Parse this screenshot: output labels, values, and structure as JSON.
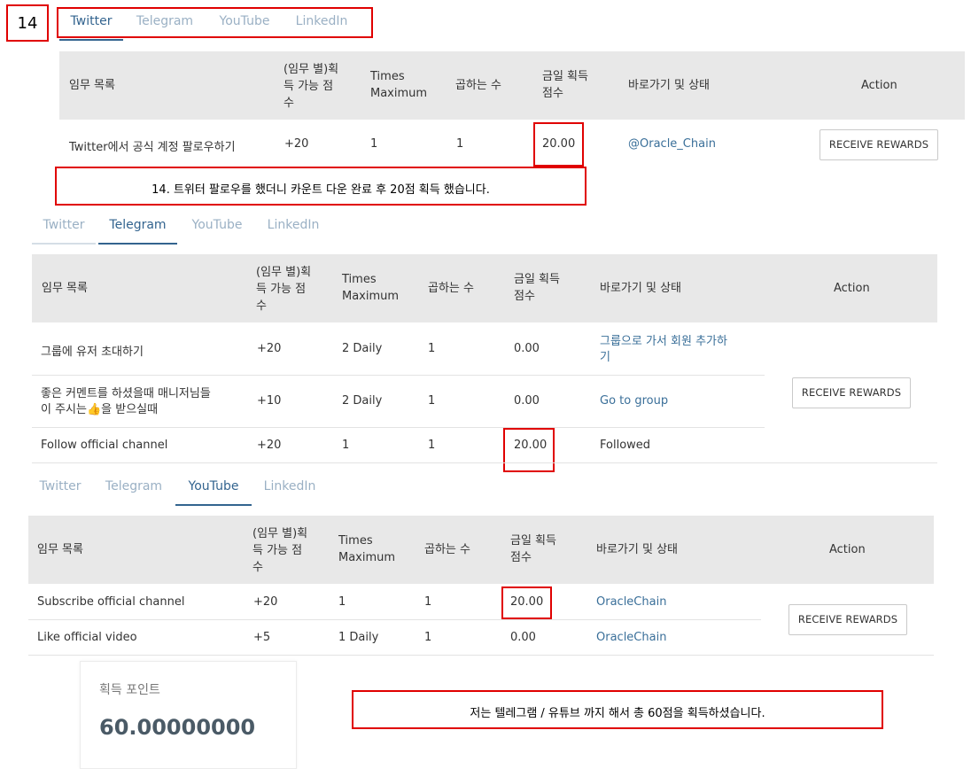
{
  "step_number": "14",
  "tab_labels": [
    "Twitter",
    "Telegram",
    "YouTube",
    "LinkedIn"
  ],
  "table_headers": [
    "임무 목록",
    "(임무 별)획득 가능 점수",
    "Times Maximum",
    "곱하는 수",
    "금일 획득 점수",
    "바로가기 및 상태",
    "Action"
  ],
  "header_lines": {
    "task": [
      "임무 목록"
    ],
    "points": [
      "(임무 별)획",
      "득 가능 점",
      "수"
    ],
    "times": [
      "Times",
      "Maximum"
    ],
    "mult": [
      "곱하는 수"
    ],
    "today": [
      "금일 획득",
      "점수"
    ],
    "link": [
      "바로가기 및 상태"
    ],
    "action": [
      "Action"
    ]
  },
  "twitter": {
    "active_tab": "Twitter",
    "rows": [
      {
        "task": "Twitter에서 공식 계정 팔로우하기",
        "points": "+20",
        "times": "1",
        "mult": "1",
        "today": "20.00",
        "link": "@Oracle_Chain"
      }
    ],
    "action_label": "RECEIVE REWARDS"
  },
  "telegram": {
    "active_tab": "Telegram",
    "rows": [
      {
        "task_lines": [
          "그룹에 유저 초대하기"
        ],
        "points": "+20",
        "times": "2 Daily",
        "mult": "1",
        "today": "0.00",
        "link_lines": [
          "그룹으로 가서 회원 추가하",
          "기"
        ]
      },
      {
        "task_lines": [
          "좋은 커멘트를 하셨을때 매니저님들",
          "이 주시는👍을 받으실때"
        ],
        "points": "+10",
        "times": "2 Daily",
        "mult": "1",
        "today": "0.00",
        "link_lines": [
          "Go to group"
        ]
      },
      {
        "task_lines": [
          "Follow official channel"
        ],
        "points": "+20",
        "times": "1",
        "mult": "1",
        "today": "20.00",
        "status": "Followed"
      }
    ],
    "action_label": "RECEIVE REWARDS"
  },
  "youtube": {
    "active_tab": "YouTube",
    "rows": [
      {
        "task": "Subscribe official channel",
        "points": "+20",
        "times": "1",
        "mult": "1",
        "today": "20.00",
        "link": "OracleChain"
      },
      {
        "task": "Like official video",
        "points": "+5",
        "times": "1 Daily",
        "mult": "1",
        "today": "0.00",
        "link": "OracleChain"
      }
    ],
    "action_label": "RECEIVE REWARDS"
  },
  "notes": {
    "twitter_note": "14. 트위터 팔로우를 했더니 카운트 다운 완료 후 20점 획득 했습니다.",
    "total_note": "저는 텔레그램 / 유튜브 까지 해서 총 60점을 획득하셨습니다."
  },
  "points_card": {
    "label": "획득 포인트",
    "value": "60.00000000"
  },
  "colors": {
    "annotation_red": "#e00000",
    "tab_active": "#33648f",
    "tab_inactive": "#9ab0c4",
    "link": "#3a6f99",
    "header_bg": "#e8e8e8"
  }
}
